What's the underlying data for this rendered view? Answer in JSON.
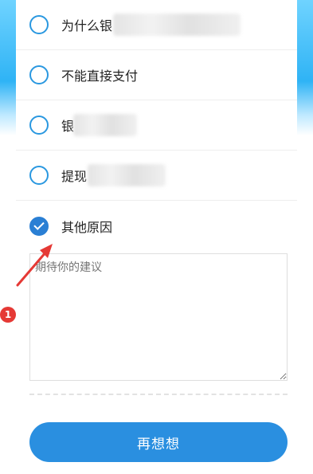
{
  "options": [
    {
      "label": "为什么银",
      "checked": false
    },
    {
      "label": "不能直接支付",
      "checked": false
    },
    {
      "label": "银",
      "checked": false
    },
    {
      "label": "提现",
      "checked": false
    },
    {
      "label": "其他原因",
      "checked": true
    }
  ],
  "suggestion": {
    "placeholder": "期待你的建议"
  },
  "button": {
    "label": "再想想"
  },
  "annotation": {
    "badge": "1"
  },
  "colors": {
    "accent": "#2a8fe0",
    "badge": "#e53935",
    "arrow": "#e53935"
  }
}
